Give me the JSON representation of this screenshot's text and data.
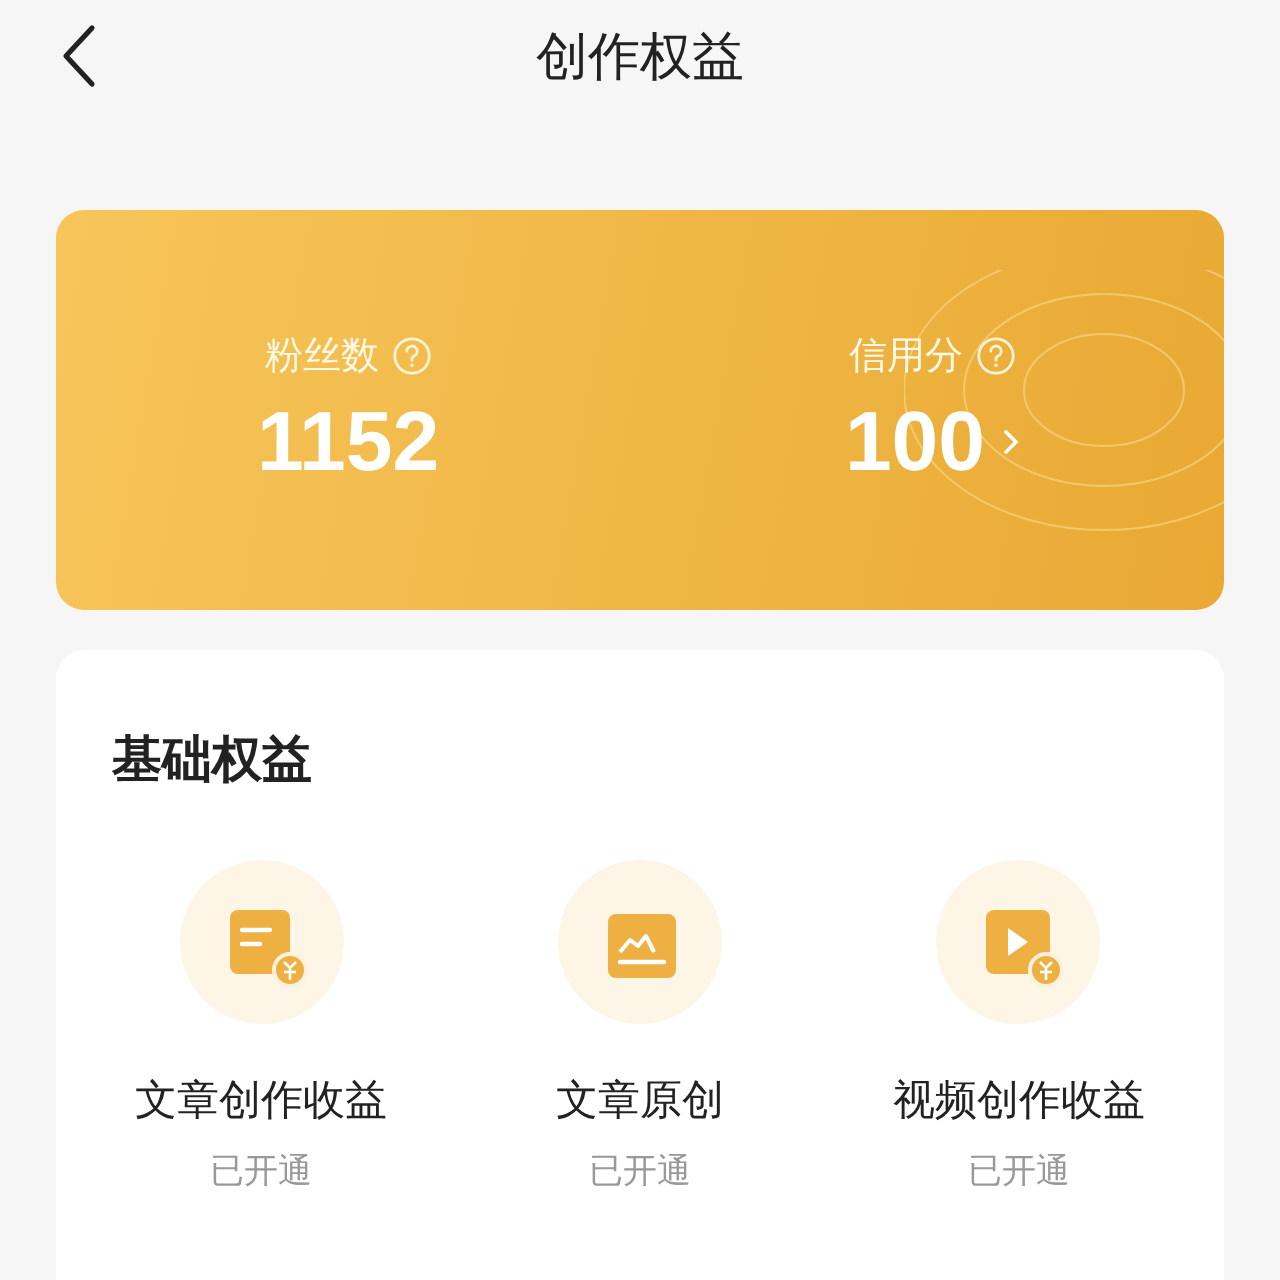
{
  "header": {
    "title": "创作权益"
  },
  "stats": [
    {
      "label": "粉丝数",
      "value": "1152",
      "has_link": false
    },
    {
      "label": "信用分",
      "value": "100",
      "has_link": true
    }
  ],
  "benefits": {
    "title": "基础权益",
    "items": [
      {
        "kind": "article-income",
        "label": "文章创作收益",
        "status": "已开通"
      },
      {
        "kind": "chart",
        "label": "文章原创",
        "status": "已开通"
      },
      {
        "kind": "video-income",
        "label": "视频创作收益",
        "status": "已开通"
      }
    ]
  }
}
